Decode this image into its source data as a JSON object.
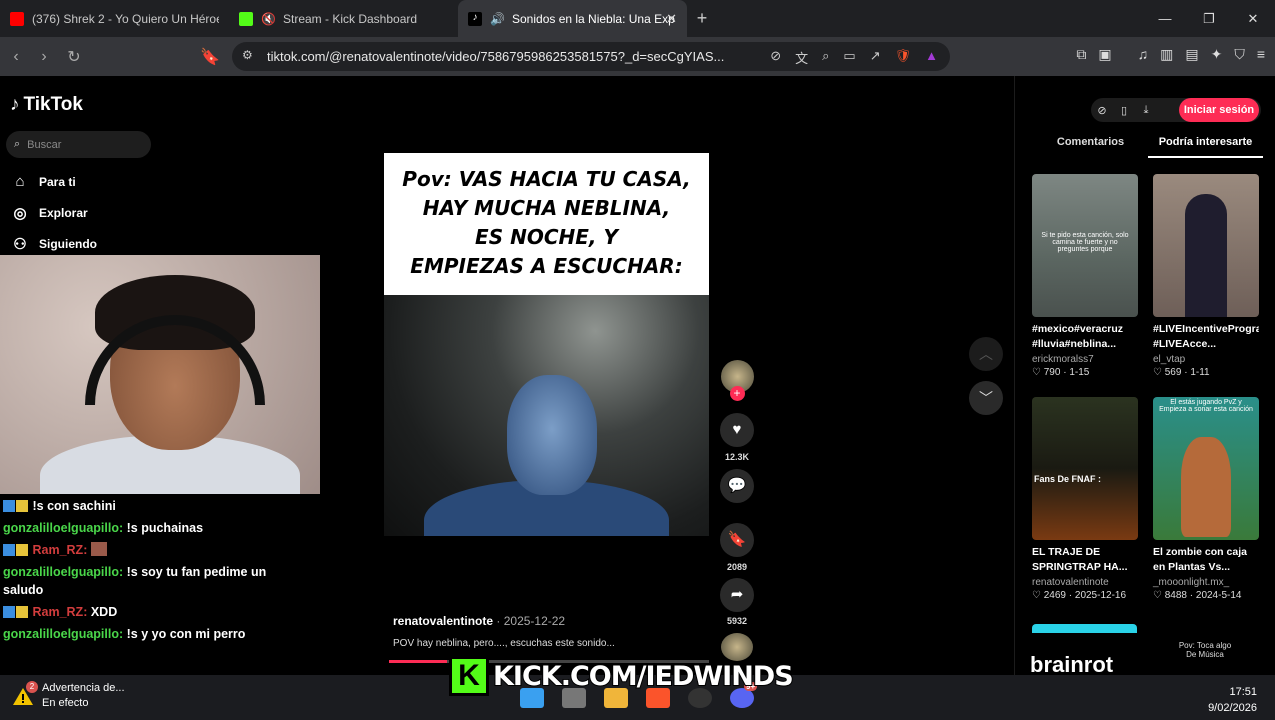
{
  "browser": {
    "tabs": [
      {
        "label": "(376) Shrek 2 - Yo Quiero Un Héroe (",
        "favicon_color": "#ff0000"
      },
      {
        "label": "Stream - Kick Dashboard",
        "favicon_color": "#53fc18"
      },
      {
        "label": "Sonidos en la Niebla: Una Exp",
        "favicon_color": "#ffffff"
      }
    ],
    "url": "tiktok.com/@renatovalentinote/video/7586795986253581575?_d=secCgYIAS..."
  },
  "sidebar": {
    "logo": "TikTok",
    "search_placeholder": "Buscar",
    "items": [
      {
        "label": "Para ti",
        "icon": "home-icon"
      },
      {
        "label": "Explorar",
        "icon": "compass-icon"
      },
      {
        "label": "Siguiendo",
        "icon": "users-icon"
      }
    ]
  },
  "chat": [
    {
      "user": "",
      "message": "!s con sachini",
      "user_color": "#d23d3d"
    },
    {
      "user": "gonzalilloelguapillo:",
      "message": "!s puchainas",
      "user_color": "#4ad64a"
    },
    {
      "user": "Ram_RZ:",
      "message": "",
      "user_color": "#d23d3d"
    },
    {
      "user": "gonzalilloelguapillo:",
      "message": "!s soy tu fan pedime un saludo",
      "user_color": "#4ad64a"
    },
    {
      "user": "Ram_RZ:",
      "message": "XDD",
      "user_color": "#d23d3d"
    },
    {
      "user": "gonzalilloelguapillo:",
      "message": "!s y yo con mi perro",
      "user_color": "#4ad64a"
    }
  ],
  "video": {
    "overlay_text": [
      "Pov: VAS HACIA TU CASA,",
      "HAY MUCHA NEBLINA,",
      "ES NOCHE, Y",
      "EMPIEZAS A ESCUCHAR:"
    ],
    "author": "renatovalentinote",
    "date": "2025-12-22",
    "caption": "POV hay neblina, pero...., escuchas este sonido...",
    "progress": 0.18
  },
  "actions": {
    "likes": "12.3K",
    "saves": "2089",
    "shares": "5932"
  },
  "right_panel": {
    "login_label": "Iniciar sesión",
    "tabs": [
      "Comentarios",
      "Podría interesarte"
    ],
    "cards": [
      {
        "title": "#mexico#veracruz #lluvia#neblina...",
        "user": "erickmoralss7",
        "meta": "♡ 790 · 1-15",
        "thumb_text": "Si te pido esta canción, solo camina te fuerte y no preguntes porque"
      },
      {
        "title": "#LIVEIncentiveProgram #LIVEAcce...",
        "user": "el_vtap",
        "meta": "♡ 569 · 1-11",
        "thumb_text": ""
      },
      {
        "title": "EL TRAJE DE SPRINGTRAP HA...",
        "user": "renatovalentinote",
        "meta": "♡ 2469 · 2025-12-16",
        "thumb_text": "Fans De FNAF :"
      },
      {
        "title": "El zombie con caja en Plantas Vs...",
        "user": "_mooonlight.mx_",
        "meta": "♡ 8488 · 2024-5-14",
        "thumb_text": "El estás jugando PvZ y Empieza a sonar esta canción"
      }
    ],
    "bottom_text_left": "brainrot",
    "bottom_text_right": "Pov: Toca algo De Música"
  },
  "taskbar": {
    "warning_title": "Advertencia de...",
    "warning_sub": "En efecto",
    "warning_badge": "2",
    "time": "17:51",
    "date": "9/02/2026",
    "discord_badge": "9+"
  },
  "overlay": {
    "kick_url": "KICK.COM/IEDWINDS",
    "kick_color": "#53fc18"
  }
}
